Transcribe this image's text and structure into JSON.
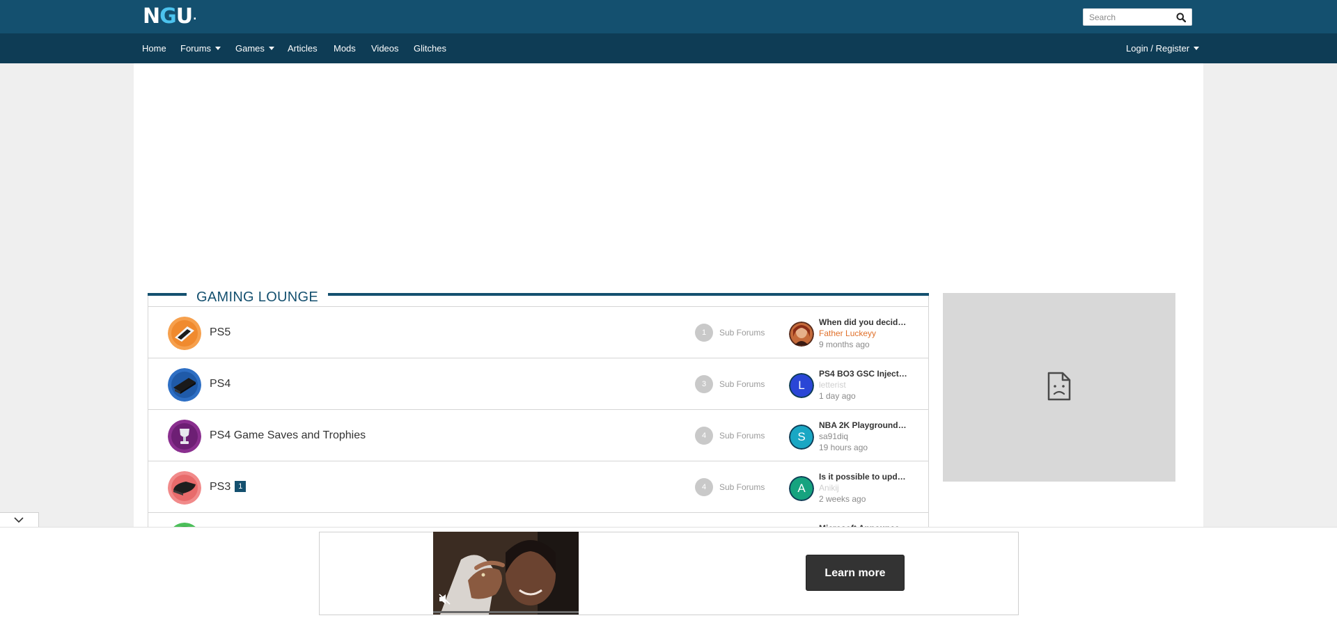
{
  "header": {
    "logo_left": "N",
    "logo_accent": "G",
    "logo_right": "U",
    "logo_mark": ".",
    "search_placeholder": "Search"
  },
  "nav": {
    "items": [
      {
        "label": "Home"
      },
      {
        "label": "Forums"
      },
      {
        "label": "Games"
      },
      {
        "label": "Articles"
      },
      {
        "label": "Mods"
      },
      {
        "label": "Videos"
      },
      {
        "label": "Glitches"
      }
    ],
    "login_label": "Login / Register"
  },
  "section": {
    "title": "GAMING LOUNGE"
  },
  "forums": [
    {
      "name": "PS5",
      "sub_count": "1",
      "sub_label": "Sub Forums",
      "last_title": "When did you decide ...",
      "last_user": "Father Luckeyy",
      "last_user_color": "#e0702a",
      "last_time": "9 months ago"
    },
    {
      "name": "PS4",
      "sub_count": "3",
      "sub_label": "Sub Forums",
      "last_title": "PS4 BO3 GSC Injector...",
      "last_user": "letterist",
      "last_user_color": "#cfcfcf",
      "avatar_letter": "L",
      "avatar_color": "#2a46d6",
      "last_time": "1 day ago"
    },
    {
      "name": "PS4 Game Saves and Trophies",
      "sub_count": "4",
      "sub_label": "Sub Forums",
      "last_title": "NBA 2K Playgrounds ...",
      "last_user": "sa91diq",
      "last_user_color": "#8a8a8a",
      "avatar_letter": "S",
      "avatar_color": "#1aa7c4",
      "last_time": "19 hours ago"
    },
    {
      "name": "PS3",
      "badge": "1",
      "sub_count": "4",
      "sub_label": "Sub Forums",
      "last_title": "Is it possible to updat...",
      "last_user": "Anikij",
      "last_user_color": "#cfcfcf",
      "avatar_letter": "A",
      "avatar_color": "#16a37f",
      "last_time": "2 weeks ago"
    },
    {
      "last_title": "Microsoft Announces..."
    }
  ],
  "ad": {
    "cta_label": "Learn more"
  },
  "colors": {
    "header_bg": "#14506f",
    "nav_bg": "#0e3c55",
    "accent": "#4cc3ee"
  }
}
